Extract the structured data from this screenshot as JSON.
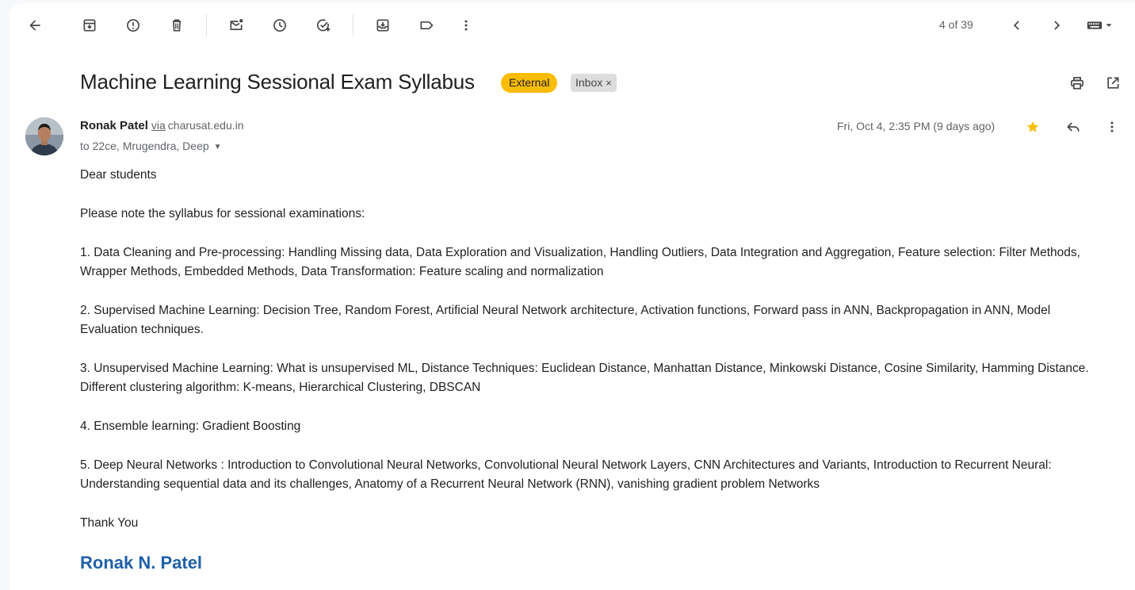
{
  "toolbar": {
    "back": "arrow-back-icon",
    "archive": "archive-icon",
    "report_spam": "report-spam-icon",
    "delete": "trash-icon",
    "mark_unread": "mark-unread-icon",
    "snooze": "snooze-icon",
    "add_task": "add-task-icon",
    "move_to": "move-to-icon",
    "labels": "label-icon",
    "more": "more-vert-icon"
  },
  "pagination": {
    "counter": "4 of 39"
  },
  "email": {
    "subject": "Machine Learning Sessional Exam Syllabus",
    "labels": {
      "external": "External",
      "inbox": "Inbox",
      "remove": "×"
    },
    "sender_name": "Ronak Patel",
    "via": "via",
    "domain": "charusat.edu.in",
    "recipients": "to 22ce, Mrugendra, Deep",
    "date": "Fri, Oct 4, 2:35 PM (9 days ago)",
    "body": {
      "greeting": "Dear students",
      "intro": "Please note the syllabus for sessional examinations:",
      "items": [
        "1. Data Cleaning and Pre-processing: Handling Missing data, Data Exploration and Visualization, Handling Outliers, Data Integration and Aggregation, Feature selection: Filter Methods, Wrapper Methods, Embedded Methods, Data Transformation: Feature scaling and normalization",
        "2. Supervised Machine Learning: Decision Tree, Random Forest, Artificial Neural Network architecture, Activation functions, Forward pass in ANN, Backpropagation in ANN, Model Evaluation techniques.",
        "3. Unsupervised Machine Learning: What is unsupervised ML, Distance Techniques: Euclidean Distance, Manhattan Distance, Minkowski Distance, Cosine Similarity, Hamming Distance. Different clustering algorithm: K-means, Hierarchical Clustering, DBSCAN",
        "4. Ensemble learning: Gradient Boosting",
        "5. Deep Neural Networks : Introduction to Convolutional Neural Networks, Convolutional Neural Network Layers, CNN Architectures and Variants, Introduction to Recurrent Neural: Understanding sequential data and its challenges, Anatomy of a Recurrent Neural Network (RNN), vanishing gradient problem Networks"
      ],
      "closing": "Thank You",
      "signature": "Ronak N. Patel"
    }
  },
  "colors": {
    "external_badge": "#fbbc04",
    "signature": "#1f5fa8",
    "star": "#fbbc04"
  }
}
